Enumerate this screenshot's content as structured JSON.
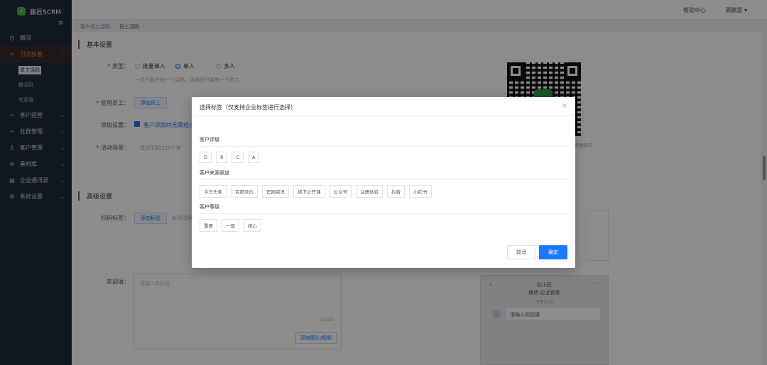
{
  "app": {
    "name": "藤匠SCRM",
    "logo_char": "✓"
  },
  "header": {
    "help": "帮助中心",
    "user": "周鹏慧"
  },
  "breadcrumb": [
    "客户员工活码",
    "员工活码"
  ],
  "sidebar": {
    "items": [
      {
        "label": "概况",
        "icon": "clock-icon",
        "glyph": "◷"
      },
      {
        "label": "引流获客",
        "icon": "share-icon",
        "glyph": "⋖",
        "active": true
      },
      {
        "label": "客户运营",
        "icon": "flow-icon",
        "glyph": "⤳"
      },
      {
        "label": "社群管理",
        "icon": "group-icon",
        "glyph": "⤳"
      },
      {
        "label": "客户管理",
        "icon": "user-icon",
        "glyph": "♙"
      },
      {
        "label": "素材库",
        "icon": "stack-icon",
        "glyph": "≋"
      },
      {
        "label": "企业通讯录",
        "icon": "book-icon",
        "glyph": "▤"
      },
      {
        "label": "系统设置",
        "icon": "gear-icon",
        "glyph": "⚙"
      }
    ],
    "sub_items": [
      "员工活码",
      "群活码",
      "欢迎语"
    ]
  },
  "form": {
    "basic_title": "基本设置",
    "type_label": "* 类型：",
    "type_options": [
      "批量单人",
      "单人",
      "多人"
    ],
    "type_hint": "一次只能生成一个活码，该码码只能有一个员工",
    "staff_label": "* 使用员工：",
    "add_staff": "添加员工",
    "add_setting_label": "添加设置：",
    "add_setting_text": "客户添加时无需经过",
    "scene_label": "* 活动场景：",
    "scene_placeholder": "建议不超过20个字",
    "advanced_title": "高级设置",
    "scan_tag_label": "扫码标签：",
    "add_tag": "添加标签",
    "scan_tag_hint": "标签说明",
    "welcome_label": "欢迎语：",
    "welcome_placeholder": "请输入欢迎语",
    "welcome_count": "0/100",
    "welcome_add": "添加图片/视频",
    "qr_caption": "添加标识"
  },
  "preview": {
    "name": "赵小匠",
    "org": "微信·企业管家",
    "time": "下午2:45",
    "message": "请输入欢迎语"
  },
  "modal": {
    "title": "选择标签（仅支持企业标签进行选择）",
    "groups": [
      {
        "title": "客户评级",
        "tags": [
          "D",
          "B",
          "C",
          "A"
        ]
      },
      {
        "title": "客户来源渠道",
        "tags": [
          "今日头条",
          "百度竞价",
          "官网资讯",
          "线下公开课",
          "公众号",
          "注册体验",
          "抖音",
          "小红书"
        ]
      },
      {
        "title": "客户等级",
        "tags": [
          "重要",
          "一般",
          "核心"
        ]
      }
    ],
    "cancel": "取消",
    "ok": "确定"
  }
}
